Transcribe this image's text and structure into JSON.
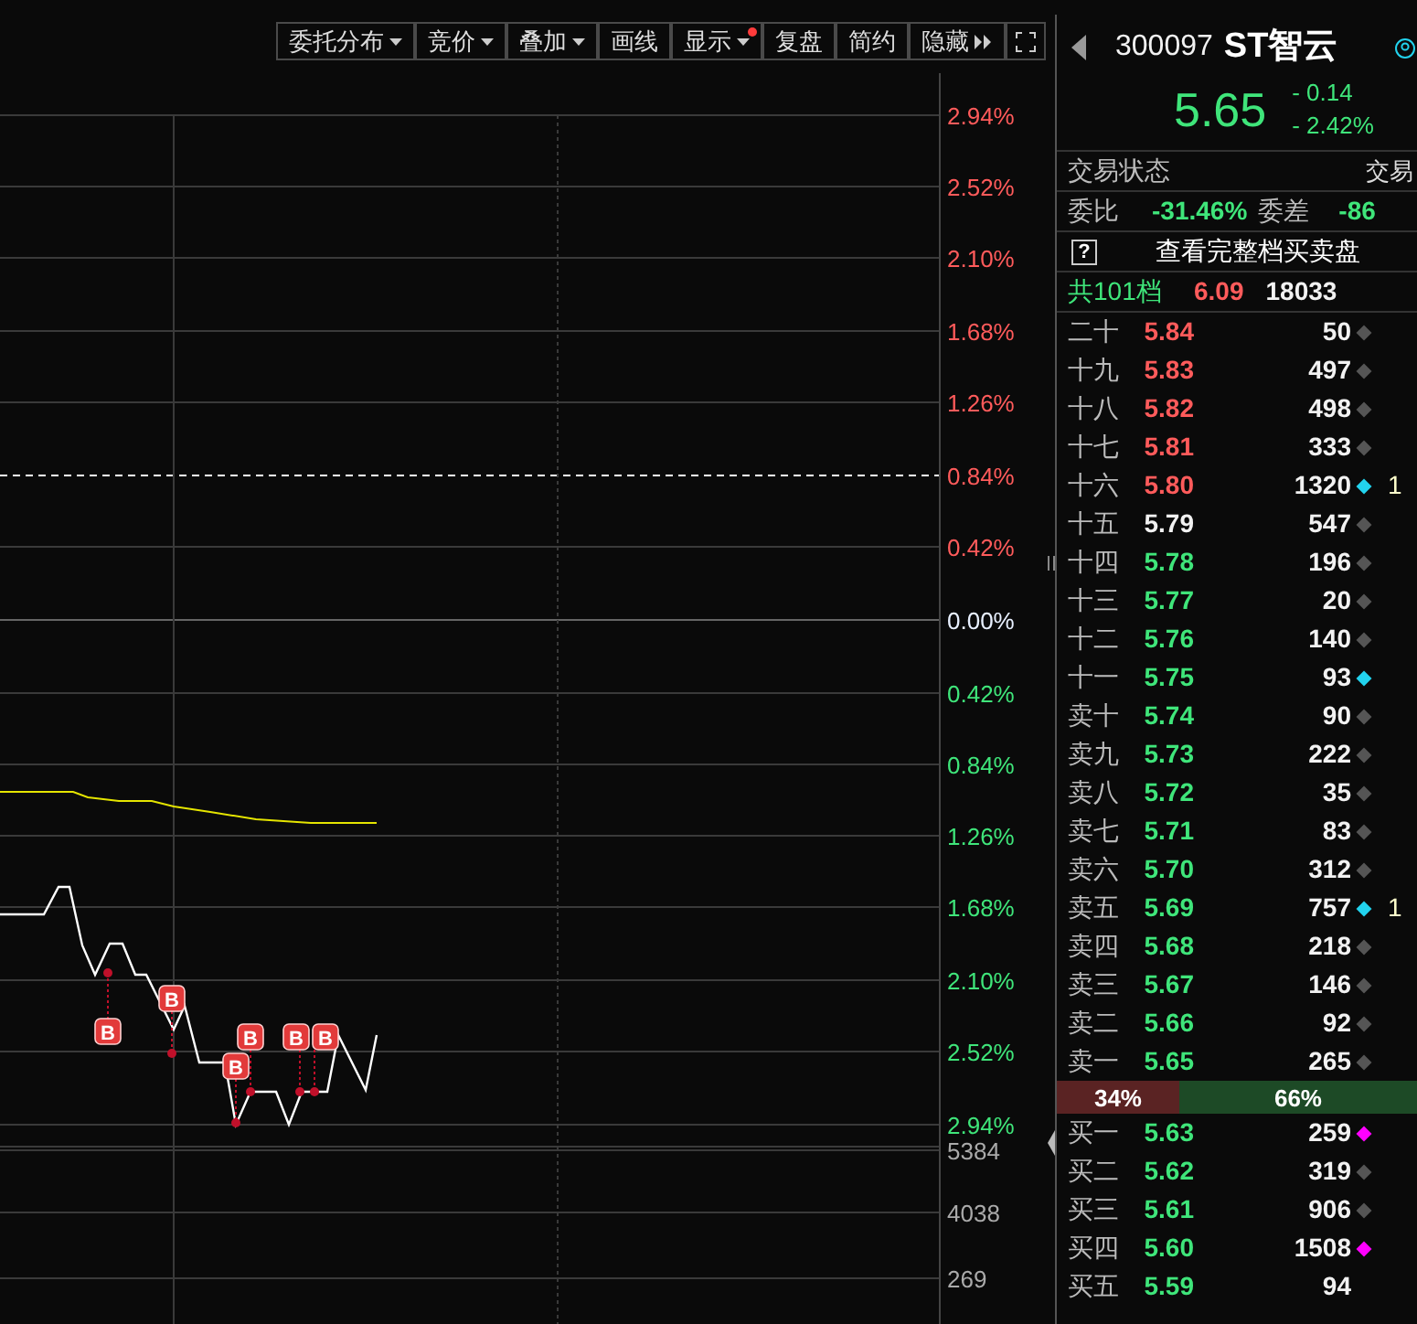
{
  "toolbar": [
    {
      "label": "委托分布",
      "dropdown": true,
      "alert": false,
      "collapse": false
    },
    {
      "label": "竞价",
      "dropdown": true,
      "alert": false,
      "collapse": false
    },
    {
      "label": "叠加",
      "dropdown": true,
      "alert": false,
      "collapse": false
    },
    {
      "label": "画线",
      "dropdown": false,
      "alert": false,
      "collapse": false
    },
    {
      "label": "显示",
      "dropdown": true,
      "alert": true,
      "collapse": false
    },
    {
      "label": "复盘",
      "dropdown": false,
      "alert": false,
      "collapse": false
    },
    {
      "label": "简约",
      "dropdown": false,
      "alert": false,
      "collapse": false
    },
    {
      "label": "隐藏",
      "dropdown": false,
      "alert": false,
      "collapse": true
    }
  ],
  "chart": {
    "price_axis": [
      {
        "text": "2.94%",
        "kind": "up"
      },
      {
        "text": "2.52%",
        "kind": "up"
      },
      {
        "text": "2.10%",
        "kind": "up"
      },
      {
        "text": "1.68%",
        "kind": "up"
      },
      {
        "text": "1.26%",
        "kind": "up"
      },
      {
        "text": "0.84%",
        "kind": "up"
      },
      {
        "text": "0.42%",
        "kind": "up"
      },
      {
        "text": "0.00%",
        "kind": "flat"
      },
      {
        "text": "0.42%",
        "kind": "down"
      },
      {
        "text": "0.84%",
        "kind": "down"
      },
      {
        "text": "1.26%",
        "kind": "down"
      },
      {
        "text": "1.68%",
        "kind": "down"
      },
      {
        "text": "2.10%",
        "kind": "down"
      },
      {
        "text": "2.52%",
        "kind": "down"
      },
      {
        "text": "2.94%",
        "kind": "down"
      }
    ],
    "volume_axis": [
      "5384",
      "4038",
      "269"
    ],
    "trade_marks": [
      {
        "label": "B"
      },
      {
        "label": "B"
      },
      {
        "label": "B"
      },
      {
        "label": "B"
      },
      {
        "label": "B"
      },
      {
        "label": "B"
      }
    ]
  },
  "quote": {
    "code": "300097",
    "name": "ST智云",
    "price": "5.65",
    "change": "- 0.14",
    "change_pct": "- 2.42%"
  },
  "status_row": {
    "label": "交易状态",
    "value": "交易"
  },
  "ratio_row": {
    "ratio_label": "委比",
    "ratio": "-31.46%",
    "diff_label": "委差",
    "diff": "-86"
  },
  "full_book_button": {
    "icon": "?",
    "label": "查看完整档买卖盘"
  },
  "total_row": {
    "label": "共101档",
    "price": "6.09",
    "volume": "18033"
  },
  "asks": [
    {
      "label": "二十",
      "price": "5.84",
      "volume": "50",
      "kind": "up",
      "color": "#555555"
    },
    {
      "label": "十九",
      "price": "5.83",
      "volume": "497",
      "kind": "up",
      "color": "#555555"
    },
    {
      "label": "十八",
      "price": "5.82",
      "volume": "498",
      "kind": "up",
      "color": "#555555"
    },
    {
      "label": "十七",
      "price": "5.81",
      "volume": "333",
      "kind": "up",
      "color": "#555555"
    },
    {
      "label": "十六",
      "price": "5.80",
      "volume": "1320",
      "kind": "up",
      "color": "#22d3ee",
      "extra": "1"
    },
    {
      "label": "十五",
      "price": "5.79",
      "volume": "547",
      "kind": "flat",
      "color": "#555555"
    },
    {
      "label": "十四",
      "price": "5.78",
      "volume": "196",
      "kind": "down",
      "color": "#555555"
    },
    {
      "label": "十三",
      "price": "5.77",
      "volume": "20",
      "kind": "down",
      "color": "#555555"
    },
    {
      "label": "十二",
      "price": "5.76",
      "volume": "140",
      "kind": "down",
      "color": "#555555"
    },
    {
      "label": "十一",
      "price": "5.75",
      "volume": "93",
      "kind": "down",
      "color": "#22d3ee"
    },
    {
      "label": "卖十",
      "price": "5.74",
      "volume": "90",
      "kind": "down",
      "color": "#555555"
    },
    {
      "label": "卖九",
      "price": "5.73",
      "volume": "222",
      "kind": "down",
      "color": "#555555"
    },
    {
      "label": "卖八",
      "price": "5.72",
      "volume": "35",
      "kind": "down",
      "color": "#555555"
    },
    {
      "label": "卖七",
      "price": "5.71",
      "volume": "83",
      "kind": "down",
      "color": "#555555"
    },
    {
      "label": "卖六",
      "price": "5.70",
      "volume": "312",
      "kind": "down",
      "color": "#555555"
    },
    {
      "label": "卖五",
      "price": "5.69",
      "volume": "757",
      "kind": "down",
      "color": "#22d3ee",
      "extra": "1"
    },
    {
      "label": "卖四",
      "price": "5.68",
      "volume": "218",
      "kind": "down",
      "color": "#555555"
    },
    {
      "label": "卖三",
      "price": "5.67",
      "volume": "146",
      "kind": "down",
      "color": "#555555"
    },
    {
      "label": "卖二",
      "price": "5.66",
      "volume": "92",
      "kind": "down",
      "color": "#555555"
    },
    {
      "label": "卖一",
      "price": "5.65",
      "volume": "265",
      "kind": "down",
      "color": "#555555"
    }
  ],
  "balance": {
    "sell": "34%",
    "buy": "66%",
    "level": 0.34
  },
  "bids": [
    {
      "label": "买一",
      "price": "5.63",
      "volume": "259",
      "kind": "down",
      "color": "#ff00ff"
    },
    {
      "label": "买二",
      "price": "5.62",
      "volume": "319",
      "kind": "down",
      "color": "#555555"
    },
    {
      "label": "买三",
      "price": "5.61",
      "volume": "906",
      "kind": "down",
      "color": "#555555"
    },
    {
      "label": "买四",
      "price": "5.60",
      "volume": "1508",
      "kind": "down",
      "color": "#ff00ff"
    },
    {
      "label": "买五",
      "price": "5.59",
      "volume": "94",
      "kind": "down"
    }
  ]
}
